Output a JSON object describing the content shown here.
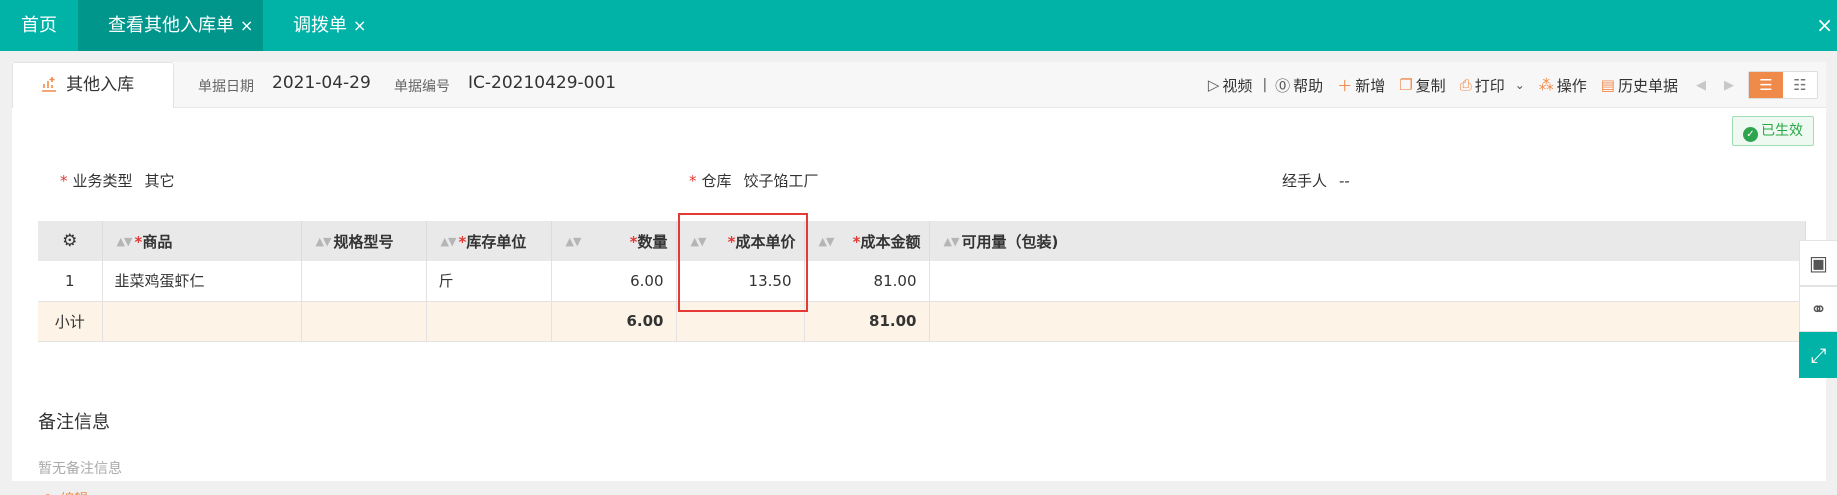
{
  "tabs": [
    {
      "label": "首页"
    },
    {
      "label": "查看其他入库单",
      "close": "×"
    },
    {
      "label": "调拨单",
      "close": "×"
    }
  ],
  "window_close": "×",
  "doc": {
    "tab_label": "其他入库",
    "date_label": "单据日期",
    "date_value": "2021-04-29",
    "number_label": "单据编号",
    "number_value": "IC-20210429-001"
  },
  "toolbar": {
    "video": "视频",
    "sep": "|",
    "help": "帮助",
    "add": "新增",
    "copy": "复制",
    "print": "打印",
    "operate": "操作",
    "history": "历史单据"
  },
  "status": "已生效",
  "fields": {
    "business_type_label": "业务类型",
    "business_type_value": "其它",
    "warehouse_label": "仓库",
    "warehouse_value": "饺子馅工厂",
    "handler_label": "经手人",
    "handler_value": "--",
    "required_mark": "*"
  },
  "table": {
    "headers": {
      "product": "商品",
      "spec": "规格型号",
      "unit": "库存单位",
      "qty": "数量",
      "unit_cost": "成本单价",
      "amount": "成本金额",
      "available": "可用量（包装)"
    },
    "rows": [
      {
        "no": "1",
        "product": "韭菜鸡蛋虾仁",
        "spec": "",
        "unit": "斤",
        "qty": "6.00",
        "unit_cost": "13.50",
        "amount": "81.00",
        "available": ""
      }
    ],
    "subtotal": {
      "label": "小计",
      "qty": "6.00",
      "amount": "81.00"
    }
  },
  "notes": {
    "title": "备注信息",
    "empty": "暂无备注信息",
    "edit": "编辑"
  },
  "colors": {
    "brand": "#01b3a7",
    "accent": "#f08a4b",
    "required": "#e53935",
    "success": "#28a745",
    "subtotal_bg": "#fdf3e6"
  }
}
